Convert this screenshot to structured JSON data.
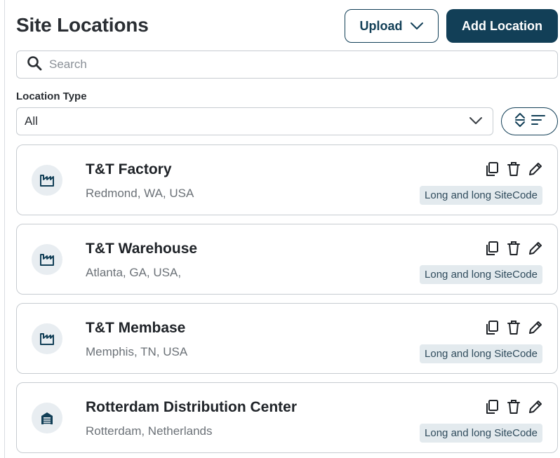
{
  "header": {
    "title": "Site Locations",
    "upload_label": "Upload",
    "add_label": "Add Location"
  },
  "search": {
    "placeholder": "Search",
    "value": ""
  },
  "filter": {
    "label": "Location Type",
    "selected": "All"
  },
  "colors": {
    "primary": "#123f57",
    "icon_bg": "#e8edf1",
    "badge_bg": "#e3eaee"
  },
  "locations": [
    {
      "name": "T&T Factory",
      "address": "Redmond, WA, USA",
      "site_code": "Long and long SiteCode",
      "icon": "factory-icon"
    },
    {
      "name": "T&T Warehouse",
      "address": "Atlanta, GA, USA,",
      "site_code": "Long and long SiteCode",
      "icon": "factory-icon"
    },
    {
      "name": "T&T Membase",
      "address": "Memphis, TN, USA",
      "site_code": "Long and long SiteCode",
      "icon": "factory-icon"
    },
    {
      "name": "Rotterdam Distribution Center",
      "address": "Rotterdam, Netherlands",
      "site_code": "Long and long SiteCode",
      "icon": "warehouse-icon"
    }
  ]
}
